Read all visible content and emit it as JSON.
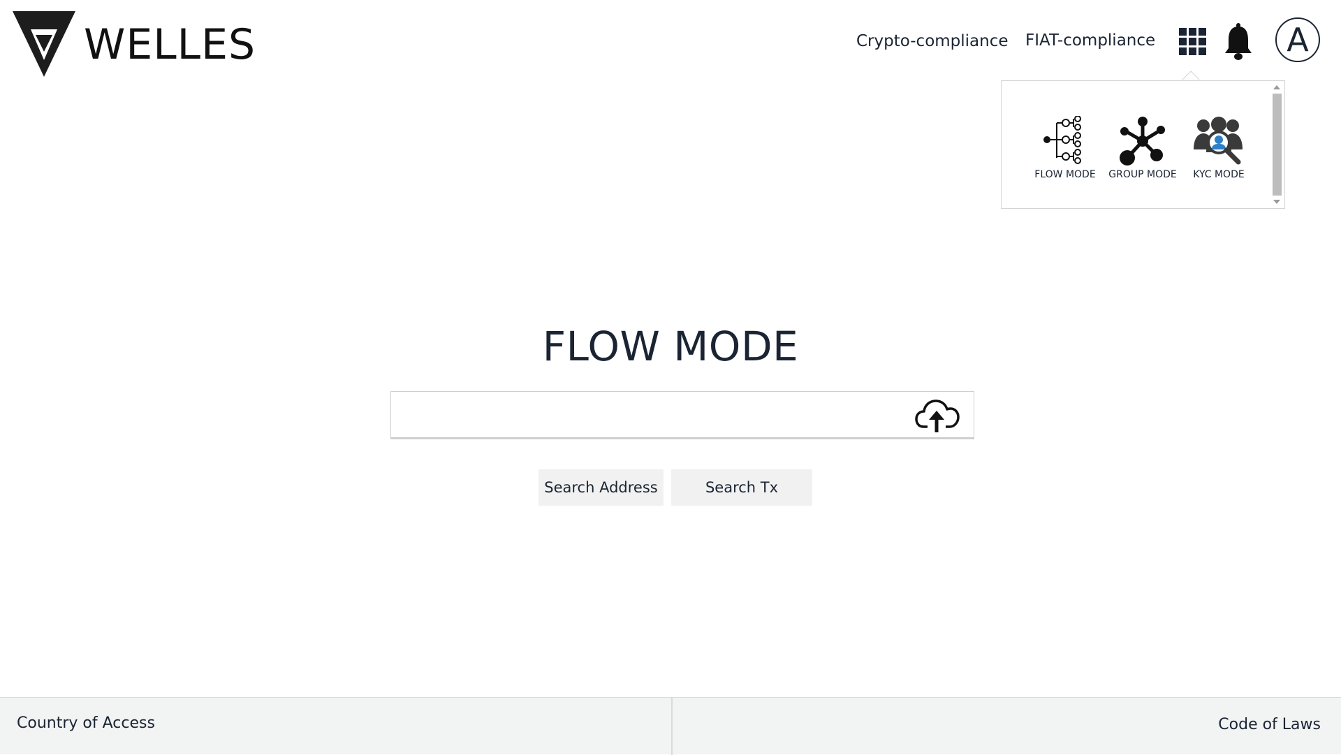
{
  "brand": {
    "name": "WELLES",
    "logo_icon": "welles-logo-icon"
  },
  "nav": {
    "crypto_label": "Crypto-compliance",
    "fiat_label": "FIAT-compliance",
    "apps_icon": "grid-icon",
    "notifications_icon": "bell-icon",
    "avatar_letter": "A"
  },
  "modes_menu": {
    "items": [
      {
        "label": "FLOW MODE",
        "icon": "flow-tree-icon"
      },
      {
        "label": "GROUP MODE",
        "icon": "network-icon"
      },
      {
        "label": "KYC MODE",
        "icon": "user-search-icon"
      }
    ]
  },
  "main": {
    "title": "FLOW MODE",
    "search": {
      "value": "",
      "placeholder": "",
      "upload_icon": "cloud-upload-icon"
    },
    "buttons": {
      "search_address": "Search Address",
      "search_tx": "Search Tx"
    }
  },
  "footer": {
    "left_label": "Country of Access",
    "right_label": "Code of Laws"
  },
  "colors": {
    "text": "#1a2433",
    "button_bg": "#f1f1f1",
    "footer_bg": "#f2f3f3",
    "kyc_accent": "#2f80c8"
  }
}
